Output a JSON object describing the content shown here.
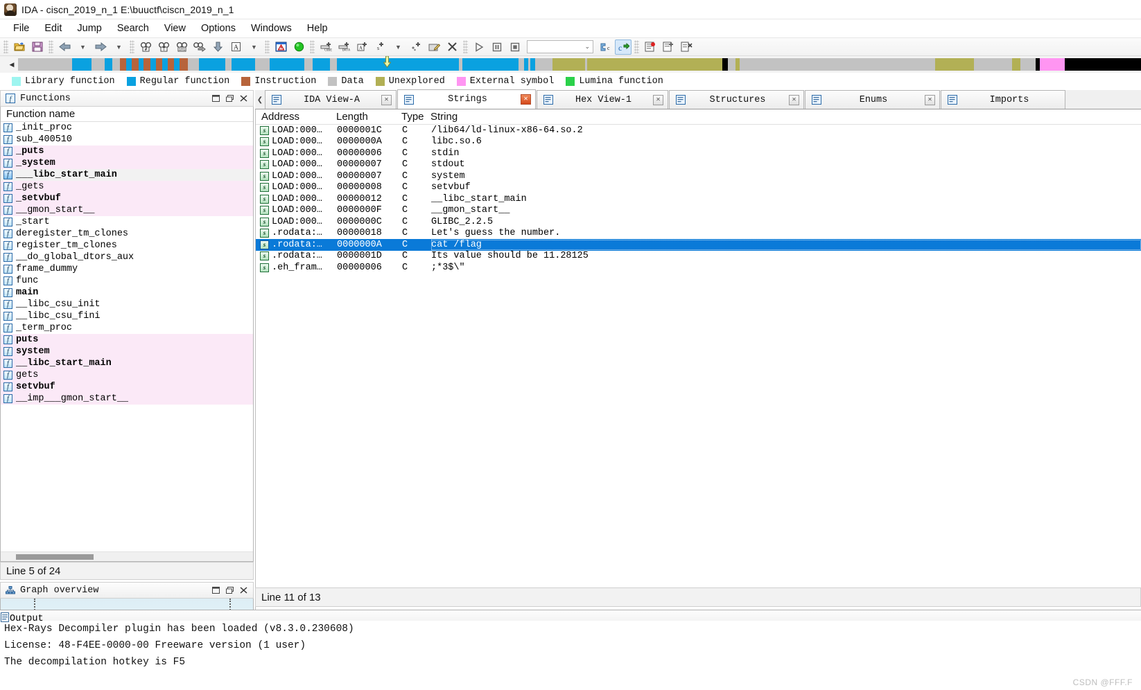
{
  "window": {
    "title": "IDA - ciscn_2019_n_1 E:\\buuctf\\ciscn_2019_n_1",
    "app_icon": "ida-logo-icon"
  },
  "menubar": {
    "items": [
      {
        "label": "File"
      },
      {
        "label": "Edit"
      },
      {
        "label": "Jump"
      },
      {
        "label": "Search"
      },
      {
        "label": "View"
      },
      {
        "label": "Options"
      },
      {
        "label": "Windows"
      },
      {
        "label": "Help"
      }
    ]
  },
  "toolbar": {
    "combo_value": "",
    "groups": [
      {
        "buttons": [
          {
            "name": "open-file-button",
            "icon": "open-folder-icon"
          },
          {
            "name": "save-file-button",
            "icon": "floppy-save-icon"
          }
        ]
      },
      {
        "buttons": [
          {
            "name": "navigate-back-button",
            "icon": "arrow-left-icon"
          },
          {
            "name": "navigate-back-dropdown",
            "icon": "chevron-down-icon"
          },
          {
            "name": "navigate-forward-button",
            "icon": "arrow-right-icon"
          },
          {
            "name": "navigate-forward-dropdown",
            "icon": "chevron-down-icon"
          }
        ]
      },
      {
        "buttons": [
          {
            "name": "search-hex-button",
            "icon": "binoculars-hash-icon"
          },
          {
            "name": "search-text-button",
            "icon": "binoculars-text-icon"
          },
          {
            "name": "search-sequence-button",
            "icon": "binoculars-101-icon"
          },
          {
            "name": "search-next-button",
            "icon": "binoculars-arrow-icon"
          },
          {
            "name": "jump-down-button",
            "icon": "arrow-down-icon"
          },
          {
            "name": "font-button",
            "icon": "letter-a-icon"
          },
          {
            "name": "font-dropdown",
            "icon": "chevron-down-icon"
          }
        ]
      },
      {
        "buttons": [
          {
            "name": "warnings-button",
            "icon": "warning-window-icon"
          },
          {
            "name": "lumina-button",
            "icon": "green-circle-icon"
          }
        ]
      },
      {
        "buttons": [
          {
            "name": "make-code-button",
            "icon": "plus-code-icon"
          },
          {
            "name": "make-data-button",
            "icon": "plus-data-icon"
          },
          {
            "name": "make-ascii-button",
            "icon": "plus-ascii-icon"
          },
          {
            "name": "make-struct-button",
            "icon": "plus-struct-icon"
          },
          {
            "name": "make-array-dropdown",
            "icon": "chevron-down-icon"
          },
          {
            "name": "undefine-button",
            "icon": "asterisk-plus-icon"
          },
          {
            "name": "rename-button",
            "icon": "rename-icon"
          },
          {
            "name": "delete-button",
            "icon": "x-delete-icon"
          }
        ]
      },
      {
        "buttons": [
          {
            "name": "run-debugger-button",
            "icon": "play-triangle-icon"
          },
          {
            "name": "pause-debugger-button",
            "icon": "pause-icon"
          },
          {
            "name": "stop-debugger-button",
            "icon": "stop-square-icon"
          }
        ]
      },
      {
        "buttons": [
          {
            "name": "decompile-function-button",
            "icon": "hexrays-c-icon"
          },
          {
            "name": "decompile-file-button",
            "icon": "hexrays-c-arrow-icon"
          }
        ]
      },
      {
        "buttons": [
          {
            "name": "breakpoints-button",
            "icon": "breakpoint-list-icon"
          },
          {
            "name": "tracing-button",
            "icon": "trace-icon"
          },
          {
            "name": "clear-trace-button",
            "icon": "clear-trace-icon"
          }
        ]
      }
    ]
  },
  "navband": {
    "left_arrow_icon": "triangle-left-icon",
    "cursor_percent": 32.5,
    "segments": [
      {
        "color": "#c2c2c2",
        "width": 5.0
      },
      {
        "color": "#0aa1e0",
        "width": 1.8
      },
      {
        "color": "#c2c2c2",
        "width": 1.2
      },
      {
        "color": "#0aa1e0",
        "width": 0.7
      },
      {
        "color": "#c2c2c2",
        "width": 0.7
      },
      {
        "color": "#b7643b",
        "width": 0.6
      },
      {
        "color": "#0aa1e0",
        "width": 0.5
      },
      {
        "color": "#b7643b",
        "width": 0.6
      },
      {
        "color": "#0aa1e0",
        "width": 0.5
      },
      {
        "color": "#b7643b",
        "width": 0.6
      },
      {
        "color": "#0aa1e0",
        "width": 0.5
      },
      {
        "color": "#b7643b",
        "width": 0.6
      },
      {
        "color": "#0aa1e0",
        "width": 0.5
      },
      {
        "color": "#b7643b",
        "width": 0.6
      },
      {
        "color": "#0aa1e0",
        "width": 0.5
      },
      {
        "color": "#b7643b",
        "width": 0.8
      },
      {
        "color": "#c2c2c2",
        "width": 1.0
      },
      {
        "color": "#0aa1e0",
        "width": 2.4
      },
      {
        "color": "#c2c2c2",
        "width": 0.6
      },
      {
        "color": "#0aa1e0",
        "width": 2.2
      },
      {
        "color": "#c2c2c2",
        "width": 1.3
      },
      {
        "color": "#0aa1e0",
        "width": 3.2
      },
      {
        "color": "#c2c2c2",
        "width": 0.8
      },
      {
        "color": "#0aa1e0",
        "width": 1.6
      },
      {
        "color": "#c2c2c2",
        "width": 0.6
      },
      {
        "color": "#0aa1e0",
        "width": 11.3
      },
      {
        "color": "#c2c2c2",
        "width": 0.3
      },
      {
        "color": "#0aa1e0",
        "width": 5.2
      },
      {
        "color": "#c2c2c2",
        "width": 0.5
      },
      {
        "color": "#0aa1e0",
        "width": 0.4
      },
      {
        "color": "#c2c2c2",
        "width": 0.2
      },
      {
        "color": "#0aa1e0",
        "width": 0.4
      },
      {
        "color": "#c2c2c2",
        "width": 1.6
      },
      {
        "color": "#b2b055",
        "width": 3.0
      },
      {
        "color": "#c2c2c2",
        "width": 0.2
      },
      {
        "color": "#b2b055",
        "width": 12.5
      },
      {
        "color": "#000000",
        "width": 0.5
      },
      {
        "color": "#c2c2c2",
        "width": 0.7
      },
      {
        "color": "#b2b055",
        "width": 0.4
      },
      {
        "color": "#c2c2c2",
        "width": 18.0
      },
      {
        "color": "#b2b055",
        "width": 3.6
      },
      {
        "color": "#c2c2c2",
        "width": 3.5
      },
      {
        "color": "#b2b055",
        "width": 0.8
      },
      {
        "color": "#c2c2c2",
        "width": 1.4
      },
      {
        "color": "#000000",
        "width": 0.4
      },
      {
        "color": "#ff95f2",
        "width": 2.3
      },
      {
        "color": "#000000",
        "width": 7.0
      }
    ]
  },
  "legend": {
    "items": [
      {
        "label": "Library function",
        "color": "#9ef5f0"
      },
      {
        "label": "Regular function",
        "color": "#0aa1e0"
      },
      {
        "label": "Instruction",
        "color": "#b7643b"
      },
      {
        "label": "Data",
        "color": "#c2c2c2"
      },
      {
        "label": "Unexplored",
        "color": "#b2b055"
      },
      {
        "label": "External symbol",
        "color": "#ff95f2"
      },
      {
        "label": "Lumina function",
        "color": "#2bd14a"
      }
    ]
  },
  "functions_panel": {
    "title": "Functions",
    "title_icon": "function-f-icon",
    "window_buttons": [
      {
        "name": "maximize-button",
        "icon": "maximize-icon"
      },
      {
        "name": "restore-button",
        "icon": "restore-icon"
      },
      {
        "name": "close-button",
        "icon": "close-icon"
      }
    ],
    "column_header": "Function name",
    "status": "Line 5 of 24",
    "rows": [
      {
        "name": "_init_proc",
        "highlight": false,
        "bold": false,
        "cursor": false
      },
      {
        "name": "sub_400510",
        "highlight": false,
        "bold": false,
        "cursor": false
      },
      {
        "name": "_puts",
        "highlight": true,
        "bold": true,
        "cursor": false
      },
      {
        "name": "_system",
        "highlight": true,
        "bold": true,
        "cursor": false
      },
      {
        "name": "___libc_start_main",
        "highlight": true,
        "bold": true,
        "cursor": true
      },
      {
        "name": "_gets",
        "highlight": true,
        "bold": false,
        "cursor": false
      },
      {
        "name": "_setvbuf",
        "highlight": true,
        "bold": true,
        "cursor": false
      },
      {
        "name": "__gmon_start__",
        "highlight": true,
        "bold": false,
        "cursor": false
      },
      {
        "name": "_start",
        "highlight": false,
        "bold": false,
        "cursor": false
      },
      {
        "name": "deregister_tm_clones",
        "highlight": false,
        "bold": false,
        "cursor": false
      },
      {
        "name": "register_tm_clones",
        "highlight": false,
        "bold": false,
        "cursor": false
      },
      {
        "name": "__do_global_dtors_aux",
        "highlight": false,
        "bold": false,
        "cursor": false
      },
      {
        "name": "frame_dummy",
        "highlight": false,
        "bold": false,
        "cursor": false
      },
      {
        "name": "func",
        "highlight": false,
        "bold": false,
        "cursor": false
      },
      {
        "name": "main",
        "highlight": false,
        "bold": true,
        "cursor": false
      },
      {
        "name": "__libc_csu_init",
        "highlight": false,
        "bold": false,
        "cursor": false
      },
      {
        "name": "__libc_csu_fini",
        "highlight": false,
        "bold": false,
        "cursor": false
      },
      {
        "name": "_term_proc",
        "highlight": false,
        "bold": false,
        "cursor": false
      },
      {
        "name": "puts",
        "highlight": true,
        "bold": true,
        "cursor": false
      },
      {
        "name": "system",
        "highlight": true,
        "bold": true,
        "cursor": false
      },
      {
        "name": "__libc_start_main",
        "highlight": true,
        "bold": true,
        "cursor": false
      },
      {
        "name": "gets",
        "highlight": true,
        "bold": false,
        "cursor": false
      },
      {
        "name": "setvbuf",
        "highlight": true,
        "bold": true,
        "cursor": false
      },
      {
        "name": "__imp___gmon_start__",
        "highlight": true,
        "bold": false,
        "cursor": false
      }
    ]
  },
  "graph_overview": {
    "title": "Graph overview",
    "title_icon": "graph-nodes-icon",
    "window_buttons": [
      {
        "name": "maximize-button",
        "icon": "maximize-icon"
      },
      {
        "name": "restore-button",
        "icon": "restore-icon"
      },
      {
        "name": "close-button",
        "icon": "close-icon"
      }
    ]
  },
  "tabs": {
    "scroll_left_icon": "chevron-left-icon",
    "items": [
      {
        "label": "IDA View-A",
        "icon": "ida-view-icon",
        "active": false,
        "close_icon": "close-icon"
      },
      {
        "label": "Strings",
        "icon": "strings-s-icon",
        "active": true,
        "close_icon": "close-icon"
      },
      {
        "label": "Hex View-1",
        "icon": "hex-view-icon",
        "active": false,
        "close_icon": "close-icon"
      },
      {
        "label": "Structures",
        "icon": "structures-a-icon",
        "active": false,
        "close_icon": "close-icon"
      },
      {
        "label": "Enums",
        "icon": "enums-list-icon",
        "active": false,
        "close_icon": "close-icon"
      },
      {
        "label": "Imports",
        "icon": "imports-icon",
        "active": false,
        "close_icon": "close-icon"
      }
    ]
  },
  "strings_view": {
    "columns": [
      "Address",
      "Length",
      "Type",
      "String"
    ],
    "status": "Line 11 of 13",
    "row_icon": "string-s-icon",
    "rows": [
      {
        "address": "LOAD:000…",
        "length": "0000001C",
        "type": "C",
        "string": "/lib64/ld-linux-x86-64.so.2",
        "selected": false
      },
      {
        "address": "LOAD:000…",
        "length": "0000000A",
        "type": "C",
        "string": "libc.so.6",
        "selected": false
      },
      {
        "address": "LOAD:000…",
        "length": "00000006",
        "type": "C",
        "string": "stdin",
        "selected": false
      },
      {
        "address": "LOAD:000…",
        "length": "00000007",
        "type": "C",
        "string": "stdout",
        "selected": false
      },
      {
        "address": "LOAD:000…",
        "length": "00000007",
        "type": "C",
        "string": "system",
        "selected": false
      },
      {
        "address": "LOAD:000…",
        "length": "00000008",
        "type": "C",
        "string": "setvbuf",
        "selected": false
      },
      {
        "address": "LOAD:000…",
        "length": "00000012",
        "type": "C",
        "string": "__libc_start_main",
        "selected": false
      },
      {
        "address": "LOAD:000…",
        "length": "0000000F",
        "type": "C",
        "string": "__gmon_start__",
        "selected": false
      },
      {
        "address": "LOAD:000…",
        "length": "0000000C",
        "type": "C",
        "string": "GLIBC_2.2.5",
        "selected": false
      },
      {
        "address": ".rodata:…",
        "length": "00000018",
        "type": "C",
        "string": "Let's guess the number.",
        "selected": false
      },
      {
        "address": ".rodata:…",
        "length": "0000000A",
        "type": "C",
        "string": "cat /flag",
        "selected": true
      },
      {
        "address": ".rodata:…",
        "length": "0000001D",
        "type": "C",
        "string": "Its value should be 11.28125",
        "selected": false
      },
      {
        "address": ".eh_fram…",
        "length": "00000006",
        "type": "C",
        "string": ";*3$\\\"",
        "selected": false
      }
    ]
  },
  "output_panel": {
    "title": "Output",
    "title_icon": "output-lines-icon",
    "lines": [
      "Hex-Rays Decompiler plugin has been loaded (v8.3.0.230608)",
      "  License: 48-F4EE-0000-00 Freeware version (1 user)",
      "  The decompilation hotkey is F5"
    ]
  },
  "watermark": "CSDN @FFF.F"
}
